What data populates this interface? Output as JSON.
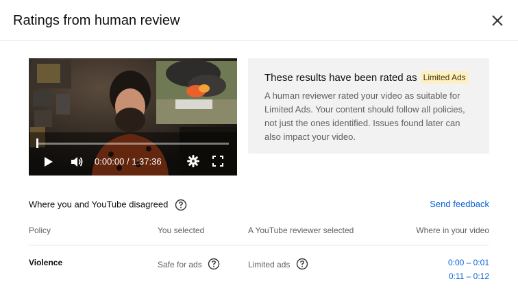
{
  "dialog": {
    "title": "Ratings from human review"
  },
  "player": {
    "time_display": "0:00:00 / 1:37:36"
  },
  "result": {
    "heading": "These results have been rated as",
    "badge": "Limited Ads",
    "description": "A human reviewer rated your video as suitable for Limited Ads. Your content should follow all policies, not just the ones identified. Issues found later can also impact your video."
  },
  "disagreement": {
    "label": "Where you and YouTube disagreed",
    "send_feedback": "Send feedback",
    "columns": [
      "Policy",
      "You selected",
      "A YouTube reviewer selected",
      "Where in your video"
    ],
    "rows": [
      {
        "policy": "Violence",
        "you_selected": "Safe for ads",
        "reviewer_selected": "Limited ads",
        "ranges": [
          "0:00 – 0:01",
          "0:11 – 0:12"
        ]
      }
    ]
  },
  "colors": {
    "link": "#065fd4",
    "badge_bg": "#fdf0c4",
    "info_bg": "#f2f2f2"
  }
}
